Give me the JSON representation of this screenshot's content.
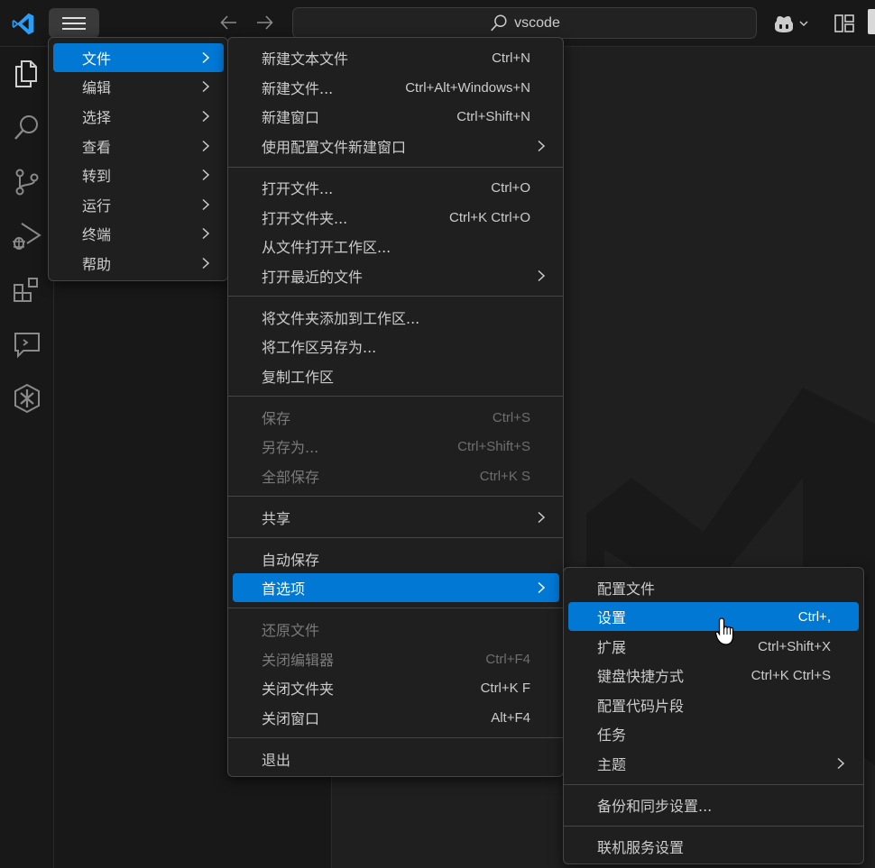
{
  "titlebar": {
    "search_text": "vscode",
    "icons": [
      "vscode-logo-icon",
      "menu-icon",
      "arrow-left-icon",
      "arrow-right-icon",
      "search-icon",
      "copilot-icon",
      "chevron-down-icon",
      "layout-icon"
    ]
  },
  "activity_bar": {
    "icons": [
      "explorer-icon",
      "search-icon",
      "source-control-icon",
      "run-debug-icon",
      "extensions-icon",
      "remote-explorer-icon",
      "ai-toolkit-icon"
    ]
  },
  "main_menu": [
    {
      "label": "文件",
      "selected": true
    },
    {
      "label": "编辑"
    },
    {
      "label": "选择"
    },
    {
      "label": "查看"
    },
    {
      "label": "转到"
    },
    {
      "label": "运行"
    },
    {
      "label": "终端"
    },
    {
      "label": "帮助"
    }
  ],
  "file_menu": {
    "items": [
      {
        "label": "新建文本文件",
        "shortcut": "Ctrl+N"
      },
      {
        "label": "新建文件...",
        "shortcut": "Ctrl+Alt+Windows+N"
      },
      {
        "label": "新建窗口",
        "shortcut": "Ctrl+Shift+N"
      },
      {
        "label": "使用配置文件新建窗口",
        "shortcut": ""
      },
      {
        "label": "打开文件...",
        "shortcut": "Ctrl+O"
      },
      {
        "label": "打开文件夹...",
        "shortcut": "Ctrl+K Ctrl+O"
      },
      {
        "label": "从文件打开工作区...",
        "shortcut": ""
      },
      {
        "label": "打开最近的文件",
        "shortcut": ""
      },
      {
        "label": "将文件夹添加到工作区...",
        "shortcut": ""
      },
      {
        "label": "将工作区另存为...",
        "shortcut": ""
      },
      {
        "label": "复制工作区",
        "shortcut": ""
      },
      {
        "label": "保存",
        "shortcut": "Ctrl+S",
        "disabled": true
      },
      {
        "label": "另存为...",
        "shortcut": "Ctrl+Shift+S",
        "disabled": true
      },
      {
        "label": "全部保存",
        "shortcut": "Ctrl+K S",
        "disabled": true
      },
      {
        "label": "共享",
        "shortcut": ""
      },
      {
        "label": "自动保存",
        "shortcut": ""
      },
      {
        "label": "首选项",
        "shortcut": "",
        "selected": true
      },
      {
        "label": "还原文件",
        "shortcut": "",
        "disabled": true
      },
      {
        "label": "关闭编辑器",
        "shortcut": "Ctrl+F4",
        "disabled": true
      },
      {
        "label": "关闭文件夹",
        "shortcut": "Ctrl+K F"
      },
      {
        "label": "关闭窗口",
        "shortcut": "Alt+F4"
      },
      {
        "label": "退出",
        "shortcut": ""
      }
    ]
  },
  "prefs_menu": {
    "items": [
      {
        "label": "配置文件",
        "shortcut": ""
      },
      {
        "label": "设置",
        "shortcut": "Ctrl+,",
        "selected": true
      },
      {
        "label": "扩展",
        "shortcut": "Ctrl+Shift+X"
      },
      {
        "label": "键盘快捷方式",
        "shortcut": "Ctrl+K Ctrl+S"
      },
      {
        "label": "配置代码片段",
        "shortcut": ""
      },
      {
        "label": "任务",
        "shortcut": ""
      },
      {
        "label": "主题",
        "shortcut": ""
      },
      {
        "label": "备份和同步设置...",
        "shortcut": ""
      },
      {
        "label": "联机服务设置",
        "shortcut": ""
      }
    ]
  },
  "colors": {
    "accent": "#0078d4",
    "background": "#1f1f1f",
    "chrome": "#181818",
    "logo": "#2a9df4"
  }
}
